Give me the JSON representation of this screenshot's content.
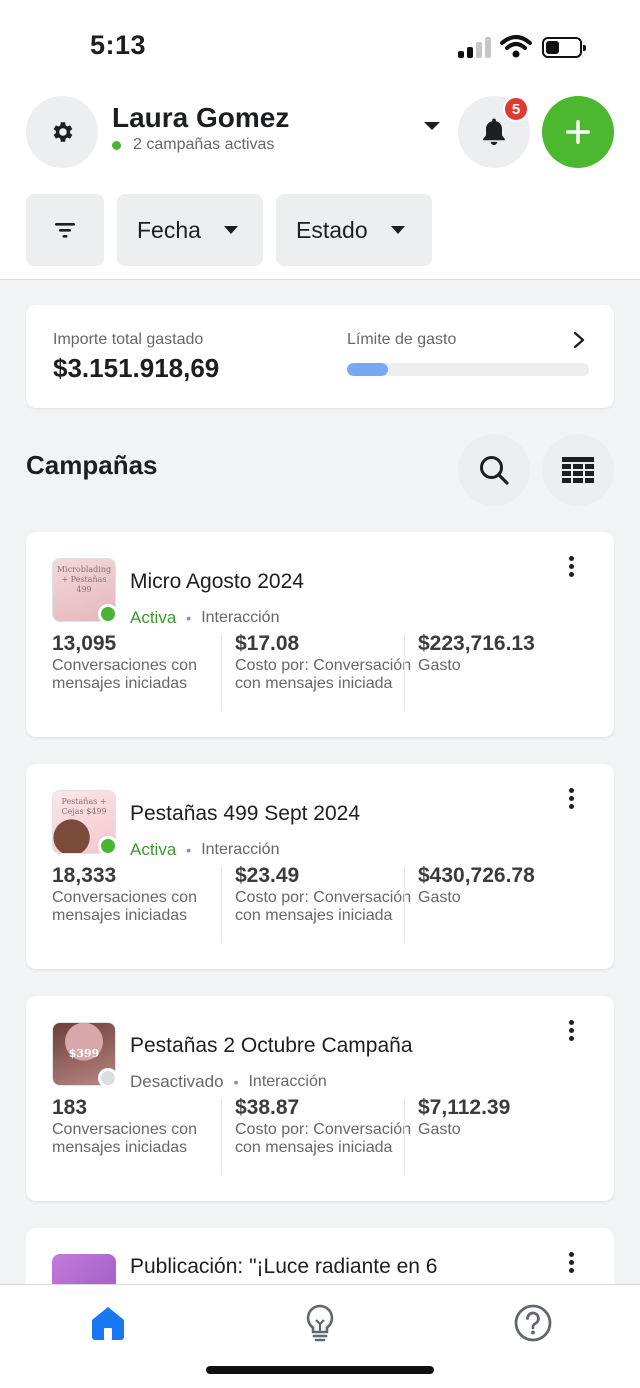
{
  "status_bar": {
    "time": "5:13"
  },
  "header": {
    "user_name": "Laura Gomez",
    "active_campaigns": "2 campañas activas",
    "notifications_count": "5",
    "icons": {
      "settings": "gear-icon",
      "notifications": "bell-icon",
      "add": "plus-icon",
      "account": "chevron-down-icon"
    }
  },
  "filters": {
    "items": [
      {
        "icon": "filter-icon"
      },
      {
        "label": "Fecha"
      },
      {
        "label": "Estado"
      }
    ]
  },
  "spend_summary": {
    "total_label": "Importe total gastado",
    "total_value": "$3.151.918,69",
    "limit_label": "Límite de gasto",
    "limit_progress_fraction": 0.17
  },
  "campaigns_section": {
    "title": "Campañas",
    "icons": {
      "search": "search-icon",
      "table": "table-icon"
    }
  },
  "campaigns": [
    {
      "name": "Micro Agosto 2024",
      "status": "Activa",
      "status_color": "#4ab533",
      "objective": "Interacción",
      "thumb_text": "Microblading + Pestañas 499",
      "metrics": [
        {
          "value": "13,095",
          "label": "Conversaciones con mensajes iniciadas"
        },
        {
          "value": "$17.08",
          "label": "Costo por: Conversación con mensajes iniciada"
        },
        {
          "value": "$223,716.13",
          "label": "Gasto"
        }
      ]
    },
    {
      "name": "Pestañas 499 Sept 2024",
      "status": "Activa",
      "status_color": "#4ab533",
      "objective": "Interacción",
      "thumb_text": "Pestañas + Cejas $499",
      "metrics": [
        {
          "value": "18,333",
          "label": "Conversaciones con mensajes iniciadas"
        },
        {
          "value": "$23.49",
          "label": "Costo por: Conversación con mensajes iniciada"
        },
        {
          "value": "$430,726.78",
          "label": "Gasto"
        }
      ]
    },
    {
      "name": "Pestañas 2 Octubre  Campaña",
      "status": "Desactivado",
      "status_color": "#dcdde0",
      "objective": "Interacción",
      "thumb_text": "$399",
      "metrics": [
        {
          "value": "183",
          "label": "Conversaciones con mensajes iniciadas"
        },
        {
          "value": "$38.87",
          "label": "Costo por: Conversación con mensajes iniciada"
        },
        {
          "value": "$7,112.39",
          "label": "Gasto"
        }
      ]
    },
    {
      "name": "Publicación: \"¡Luce radiante en 6"
    }
  ],
  "tab_bar": {
    "tabs": [
      {
        "icon": "home-icon",
        "active": true
      },
      {
        "icon": "lightbulb-icon",
        "active": false
      },
      {
        "icon": "help-icon",
        "active": false
      }
    ]
  },
  "colors": {
    "accent": "#4cb82f",
    "active_status": "#3a9a2c",
    "tab_active": "#1877f2",
    "badge": "#e0392e"
  }
}
